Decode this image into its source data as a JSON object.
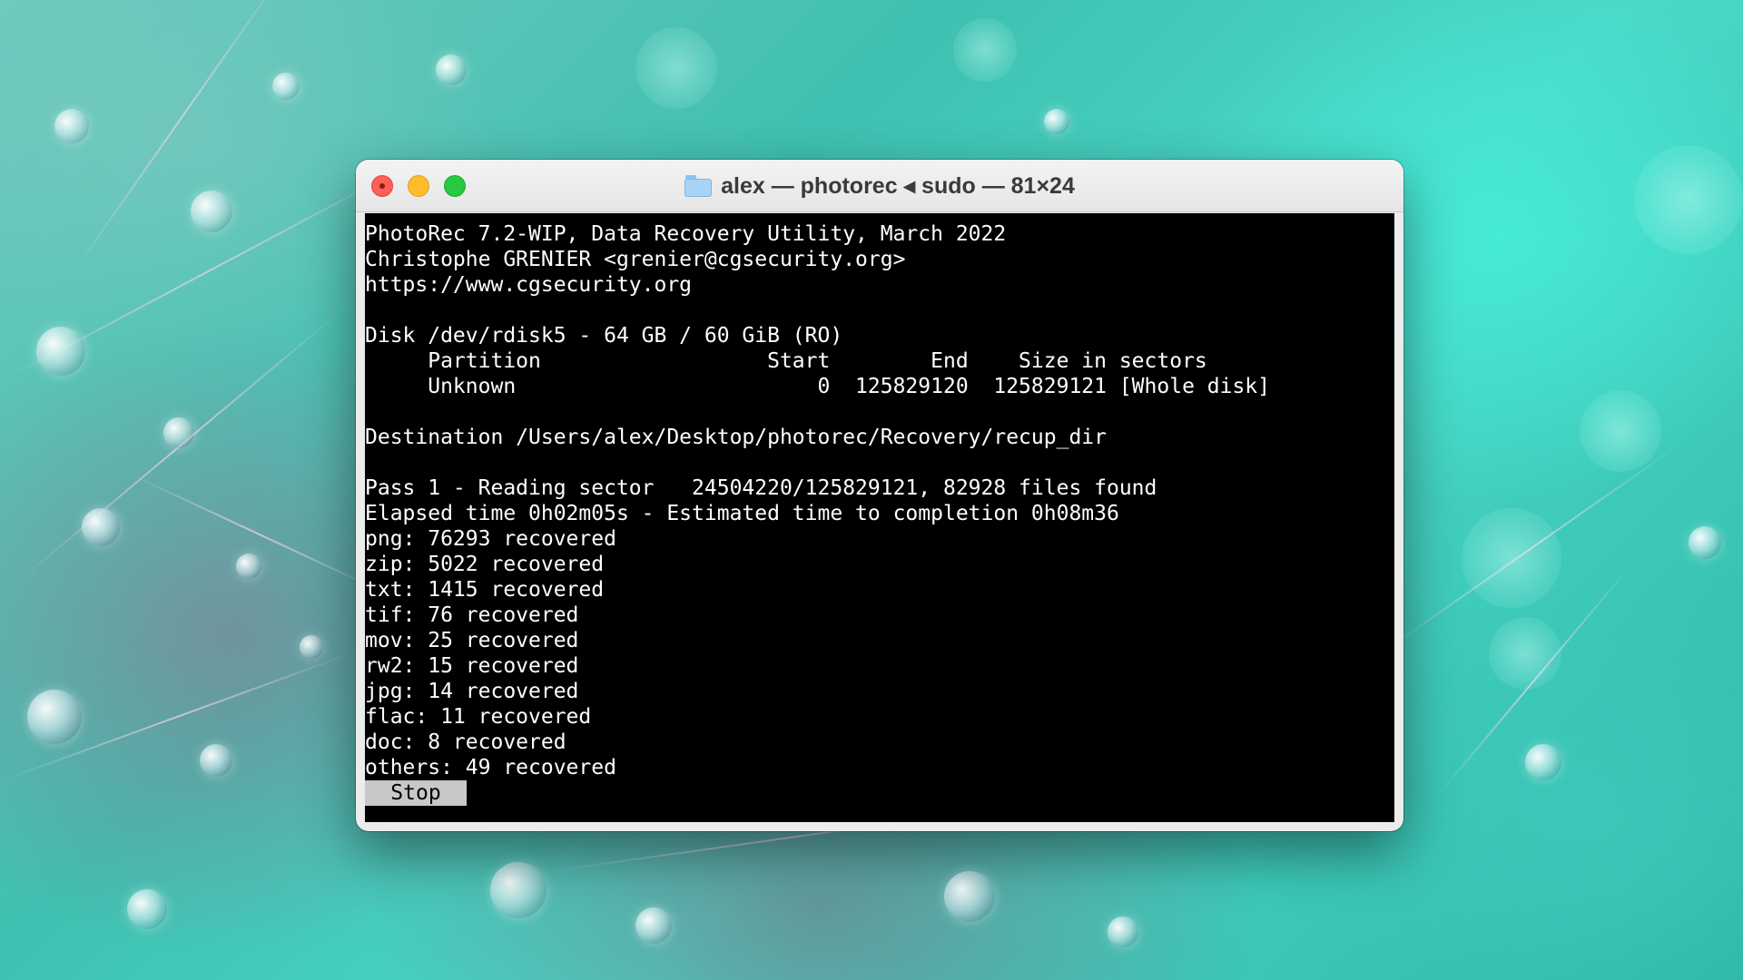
{
  "window": {
    "title": "alex — photorec ◂ sudo — 81×24",
    "folder_icon": "folder-icon"
  },
  "terminal": {
    "header": [
      "PhotoRec 7.2-WIP, Data Recovery Utility, March 2022",
      "Christophe GRENIER <grenier@cgsecurity.org>",
      "https://www.cgsecurity.org"
    ],
    "disk": {
      "line": "Disk /dev/rdisk5 - 64 GB / 60 GiB (RO)",
      "table_header": "     Partition                  Start        End    Size in sectors",
      "table_row": "     Unknown                        0  125829120  125829121 [Whole disk]"
    },
    "destination": "Destination /Users/alex/Desktop/photorec/Recovery/recup_dir",
    "progress": {
      "pass_line": "Pass 1 - Reading sector   24504220/125829121, 82928 files found",
      "elapsed_line": "Elapsed time 0h02m05s - Estimated time to completion 0h08m36"
    },
    "recovered": [
      "png: 76293 recovered",
      "zip: 5022 recovered",
      "txt: 1415 recovered",
      "tif: 76 recovered",
      "mov: 25 recovered",
      "rw2: 15 recovered",
      "jpg: 14 recovered",
      "flac: 11 recovered",
      "doc: 8 recovered",
      "others: 49 recovered"
    ],
    "stop_label": "Stop"
  },
  "colors": {
    "terminal_bg": "#000000",
    "terminal_fg": "#ffffff",
    "close": "#ff5f57",
    "minimize": "#febc2e",
    "maximize": "#28c840"
  }
}
